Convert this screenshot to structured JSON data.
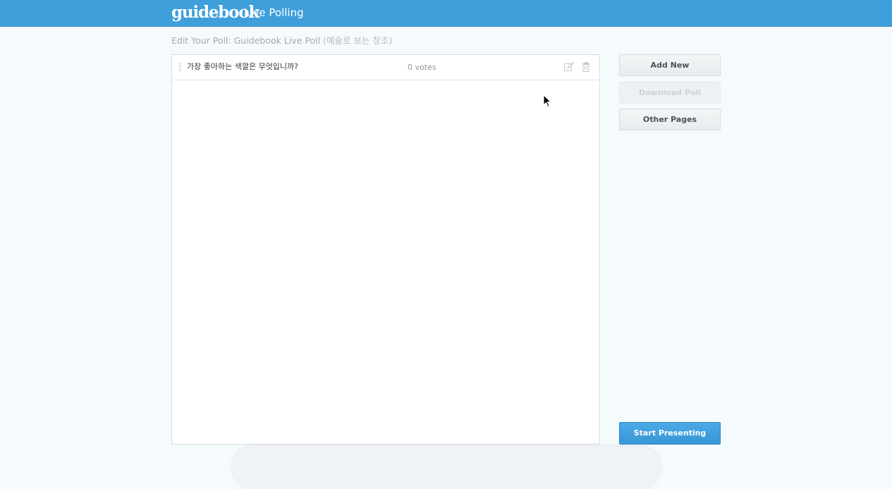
{
  "header": {
    "logo_text": "guidebook",
    "app_name": "Live Polling"
  },
  "page": {
    "heading": "Edit Your Poll: Guidebook Live Poll",
    "subheading": "(예술로 보는 창조)"
  },
  "poll": {
    "questions": [
      {
        "text": "가장 좋아하는 색깔은 무엇입니까?",
        "votes": "0 votes"
      }
    ]
  },
  "sidebar": {
    "add_new_label": "Add New",
    "download_poll_label": "Download Poll",
    "other_pages_label": "Other Pages",
    "start_presenting_label": "Start Presenting"
  },
  "colors": {
    "header_bg": "#3f9fdb",
    "primary_button": "#3a96d6",
    "page_bg": "#f5fafd"
  },
  "icons": {
    "edit": "edit-icon",
    "delete": "trash-icon",
    "drag": "drag-handle-icon"
  }
}
